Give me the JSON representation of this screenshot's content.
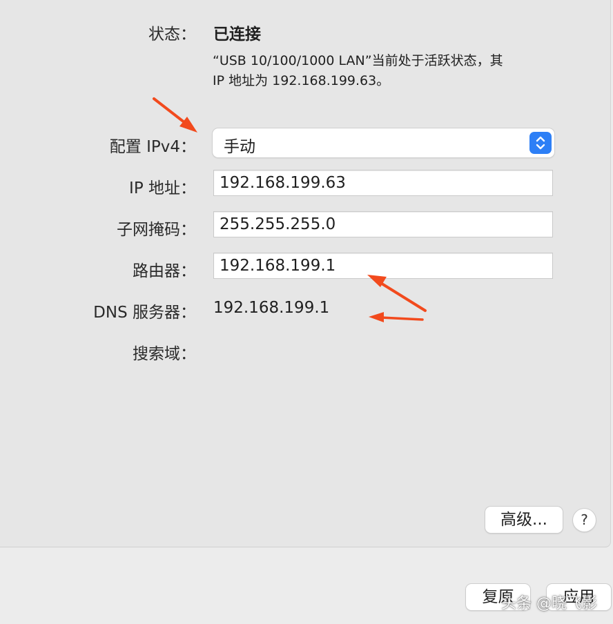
{
  "status": {
    "label": "状态：",
    "value": "已连接",
    "description_line1": "“USB 10/100/1000 LAN”当前处于活跃状态，其",
    "description_line2": "IP 地址为 192.168.199.63。"
  },
  "configure_ipv4": {
    "label": "配置 IPv4：",
    "selected": "手动"
  },
  "ip_address": {
    "label": "IP 地址：",
    "value": "192.168.199.63"
  },
  "subnet_mask": {
    "label": "子网掩码：",
    "value": "255.255.255.0"
  },
  "router": {
    "label": "路由器：",
    "value": "192.168.199.1"
  },
  "dns": {
    "label": "DNS 服务器：",
    "value": "192.168.199.1"
  },
  "search_domains": {
    "label": "搜索域：",
    "value": ""
  },
  "buttons": {
    "advanced": "高级...",
    "help": "?",
    "revert": "复原",
    "apply": "应用"
  },
  "watermark": "头条 @晓飞影",
  "colors": {
    "accent": "#2d7ff6",
    "annotation_arrow": "#f24a1d",
    "panel_bg": "#e6e6e6"
  }
}
